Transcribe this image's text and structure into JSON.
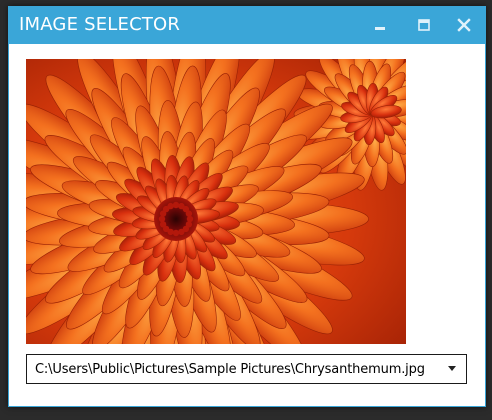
{
  "window": {
    "title": "IMAGE SELECTOR",
    "accent_color": "#3aa6d8",
    "controls": {
      "minimize_icon": "minimize-icon",
      "maximize_icon": "maximize-icon",
      "close_icon": "close-icon"
    }
  },
  "image": {
    "subject": "Chrysanthemum"
  },
  "selector": {
    "selected_value": "C:\\Users\\Public\\Pictures\\Sample Pictures\\Chrysanthemum.jpg",
    "dropdown_icon": "chevron-down-icon"
  }
}
